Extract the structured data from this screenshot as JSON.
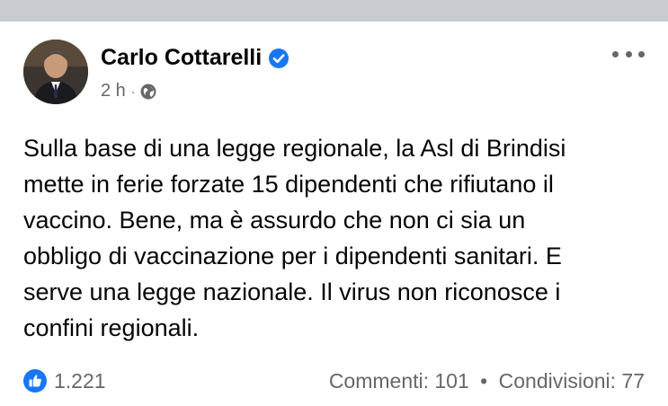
{
  "post": {
    "author": "Carlo Cottarelli",
    "time": "2 h",
    "meta_separator": "·",
    "body_lines": [
      "Sulla base di una legge regionale, la Asl di Brindisi",
      "mette in ferie forzate 15 dipendenti che rifiutano il",
      "vaccino. Bene, ma è assurdo che non ci sia un",
      "obbligo di vaccinazione per i dipendenti sanitari. E",
      "serve una legge nazionale. Il virus non riconosce i",
      "confini regionali."
    ],
    "reactions_count": "1.221",
    "comments": "Commenti: 101",
    "stats_separator": "•",
    "shares": "Condivisioni: 77"
  },
  "icons": {
    "verified": "verified-badge-icon",
    "audience": "globe-icon",
    "menu": "more-options-icon",
    "reaction": "like-icon"
  },
  "colors": {
    "brand_blue": "#1877f2",
    "text_primary": "#050505",
    "text_secondary": "#65676b",
    "top_strip": "#c9ccd1"
  }
}
